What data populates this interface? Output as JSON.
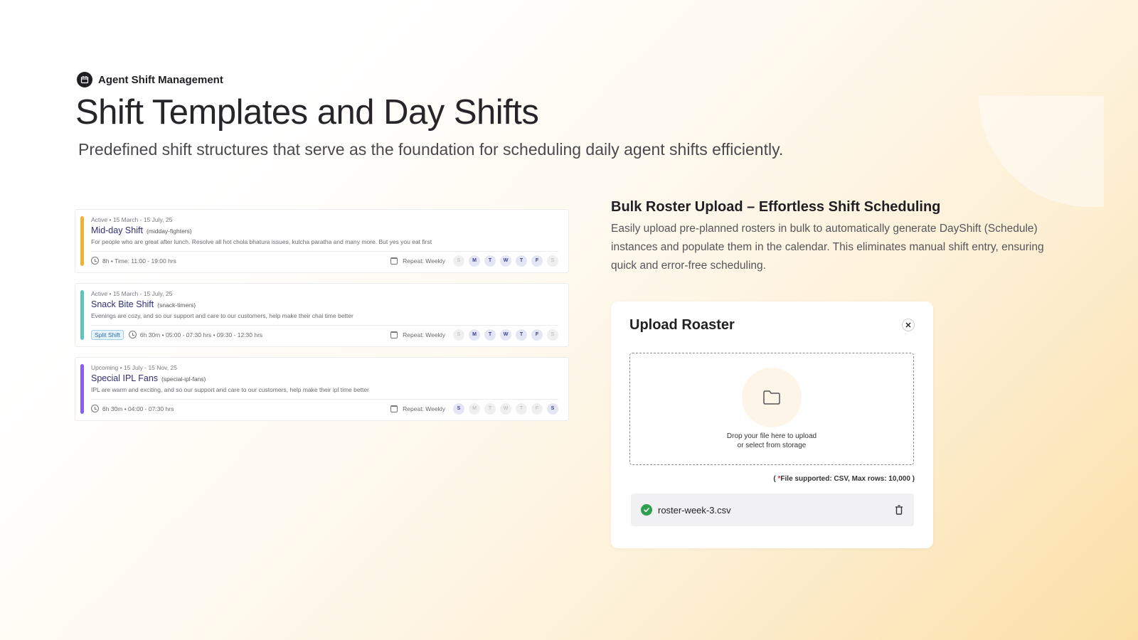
{
  "header": {
    "brand_label": "Agent Shift Management",
    "brand_icon": "calendar-icon",
    "title": "Shift Templates and Day Shifts",
    "subtitle": "Predefined shift structures that serve as the foundation for scheduling daily agent shifts efficiently."
  },
  "shifts": [
    {
      "status": "Active • 15 March - 15 July, 25",
      "name": "Mid-day Shift",
      "slug": "(midday-fighters)",
      "description": "For people who are great after lunch. Resolve all hot chola bhatura issues, kulcha paratha and many more. But yes you eat first",
      "timing": "8h • Time: 11:00 - 19:00 hrs",
      "repeat": "Repeat: Weekly",
      "accent_color": "#f2b035",
      "split_label": "",
      "days": [
        {
          "label": "S",
          "active": false
        },
        {
          "label": "M",
          "active": true
        },
        {
          "label": "T",
          "active": true
        },
        {
          "label": "W",
          "active": true
        },
        {
          "label": "T",
          "active": true
        },
        {
          "label": "F",
          "active": true
        },
        {
          "label": "S",
          "active": false
        }
      ]
    },
    {
      "status": "Active • 15 March - 15 July, 25",
      "name": "Snack Bite Shift",
      "slug": "(snack-timers)",
      "description": "Evenings are cozy, and so our support and care to our customers, help make their chai time better",
      "timing": "6h 30m • 05:00 - 07:30 hrs • 09:30 - 12:30 hrs",
      "repeat": "Repeat: Weekly",
      "accent_color": "#5ec4c0",
      "split_label": "Split Shift",
      "days": [
        {
          "label": "S",
          "active": false
        },
        {
          "label": "M",
          "active": true
        },
        {
          "label": "T",
          "active": true
        },
        {
          "label": "W",
          "active": true
        },
        {
          "label": "T",
          "active": true
        },
        {
          "label": "F",
          "active": true
        },
        {
          "label": "S",
          "active": false
        }
      ]
    },
    {
      "status": "Upcoming • 15 July - 15 Nov, 25",
      "name": "Special IPL Fans",
      "slug": "(special-ipl-fans)",
      "description": "IPL are warm and exciting, and so our support and care to our customers, help make their ipl time better",
      "timing": "6h 30m • 04:00 - 07:30 hrs",
      "repeat": "Repeat: Weekly",
      "accent_color": "#8b5cf6",
      "split_label": "",
      "days": [
        {
          "label": "S",
          "active": true
        },
        {
          "label": "M",
          "active": false
        },
        {
          "label": "T",
          "active": false
        },
        {
          "label": "W",
          "active": false
        },
        {
          "label": "T",
          "active": false
        },
        {
          "label": "F",
          "active": false
        },
        {
          "label": "S",
          "active": true
        }
      ]
    }
  ],
  "bulk": {
    "heading": "Bulk Roster Upload – Effortless Shift Scheduling",
    "description": "Easily upload pre-planned rosters in bulk to automatically generate DayShift (Schedule) instances and populate them in the calendar. This eliminates manual shift entry, ensuring quick and error-free scheduling."
  },
  "dialog": {
    "title": "Upload Roaster",
    "close_icon": "close-icon",
    "drop_line1": "Drop your file here to upload",
    "drop_line2": "or select from storage",
    "note_prefix": "( ",
    "note_star": "*",
    "note_text": "File supported: CSV, Max rows: 10,000 )",
    "file_name": "roster-week-3.csv",
    "file_status_icon": "check-circle-icon",
    "delete_icon": "trash-icon"
  }
}
